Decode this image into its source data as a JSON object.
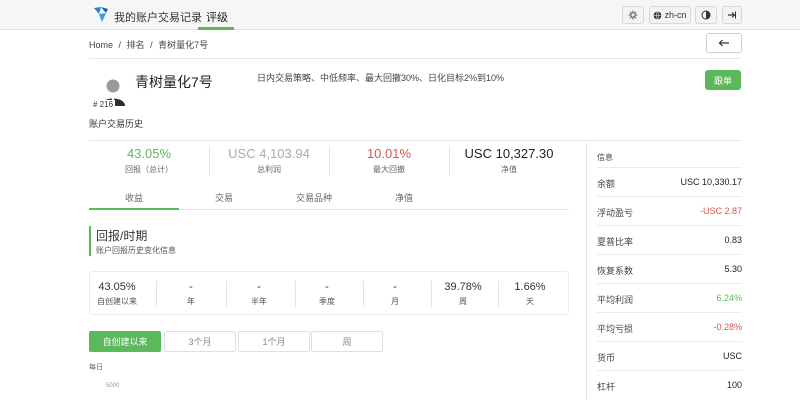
{
  "nav": {
    "items": [
      "我的账户",
      "交易记录",
      "评级"
    ],
    "lang": "zh-cn"
  },
  "breadcrumb": [
    "Home",
    "/",
    "排名",
    "/",
    "青树量化7号"
  ],
  "account": {
    "name": "青树量化7号",
    "rank": "# 216",
    "description": "日内交易策略、中低频率、最大回撤30%、日化目标2%到10%",
    "history_label": "账户交易历史",
    "follow_label": "跟单"
  },
  "stats": [
    {
      "value": "43.05%",
      "label": "回报（总计）",
      "color": "green"
    },
    {
      "value": "USC 4,103.94",
      "label": "总利润",
      "color": "gray"
    },
    {
      "value": "10.01%",
      "label": "最大回撤",
      "color": "red"
    },
    {
      "value": "USC 10,327.30",
      "label": "净值",
      "color": "dark"
    }
  ],
  "tabs": [
    "收益",
    "交易",
    "交易品种",
    "净值"
  ],
  "section": {
    "title": "回报/时期",
    "subtitle": "账户回报历史变化信息"
  },
  "periods": [
    {
      "value": "43.05%",
      "label": "自创建以来"
    },
    {
      "value": "-",
      "label": "年"
    },
    {
      "value": "-",
      "label": "半年"
    },
    {
      "value": "-",
      "label": "季度"
    },
    {
      "value": "-",
      "label": "月"
    },
    {
      "value": "39.78%",
      "label": "周"
    },
    {
      "value": "1.66%",
      "label": "天"
    }
  ],
  "range_buttons": [
    "自创建以来",
    "3个月",
    "1个月",
    "周"
  ],
  "chart": {
    "interval_label": "每日",
    "y_tick": "5000"
  },
  "info": {
    "title": "信息",
    "rows": [
      {
        "key": "余额",
        "value": "USC 10,330.17",
        "color": "dark"
      },
      {
        "key": "浮动盈亏",
        "value": "-USC 2.87",
        "color": "red"
      },
      {
        "key": "夏普比率",
        "value": "0.83",
        "color": "dark"
      },
      {
        "key": "恢复系数",
        "value": "5.30",
        "color": "dark"
      },
      {
        "key": "平均利润",
        "value": "6.24%",
        "color": "green"
      },
      {
        "key": "平均亏损",
        "value": "-0.28%",
        "color": "red"
      },
      {
        "key": "货币",
        "value": "USC",
        "color": "dark"
      },
      {
        "key": "杠杆",
        "value": "100",
        "color": "dark"
      }
    ]
  },
  "colors": {
    "accent": "#5cb85c",
    "negative": "#d9534f"
  }
}
